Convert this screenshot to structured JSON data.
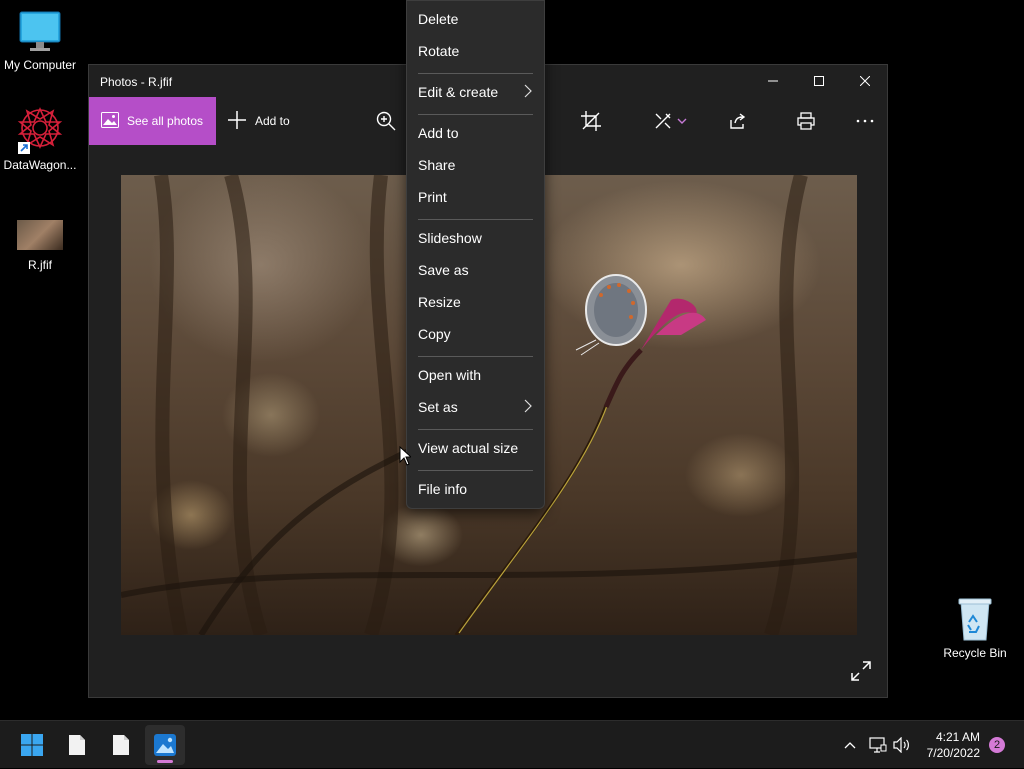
{
  "desktop": {
    "icons": [
      {
        "label": "My Computer"
      },
      {
        "label": "DataWagon..."
      },
      {
        "label": "R.jfif"
      },
      {
        "label": "Recycle Bin"
      }
    ]
  },
  "window": {
    "title": "Photos - R.jfif",
    "toolbar": {
      "see_all_label": "See all photos",
      "add_to_label": "Add to",
      "icons": [
        "zoom-icon",
        "crop-icon",
        "edit-icon",
        "share-icon",
        "print-icon",
        "more-icon"
      ]
    },
    "controls": [
      "minimize-icon",
      "maximize-icon",
      "close-icon"
    ]
  },
  "context_menu": {
    "items": [
      {
        "label": "Delete"
      },
      {
        "label": "Rotate"
      },
      {
        "label": "Edit & create",
        "submenu": true
      },
      {
        "label": "Add to"
      },
      {
        "label": "Share"
      },
      {
        "label": "Print"
      },
      {
        "label": "Slideshow"
      },
      {
        "label": "Save as"
      },
      {
        "label": "Resize"
      },
      {
        "label": "Copy"
      },
      {
        "label": "Open with"
      },
      {
        "label": "Set as",
        "submenu": true
      },
      {
        "label": "View actual size"
      },
      {
        "label": "File info"
      }
    ]
  },
  "taskbar": {
    "time": "4:21 AM",
    "date": "7/20/2022",
    "notification_count": "2"
  },
  "colors": {
    "accent": "#b54ec8",
    "menu_bg": "#2b2b2b",
    "window_bg": "#202020",
    "taskbar_bg": "#1c1c1c"
  }
}
